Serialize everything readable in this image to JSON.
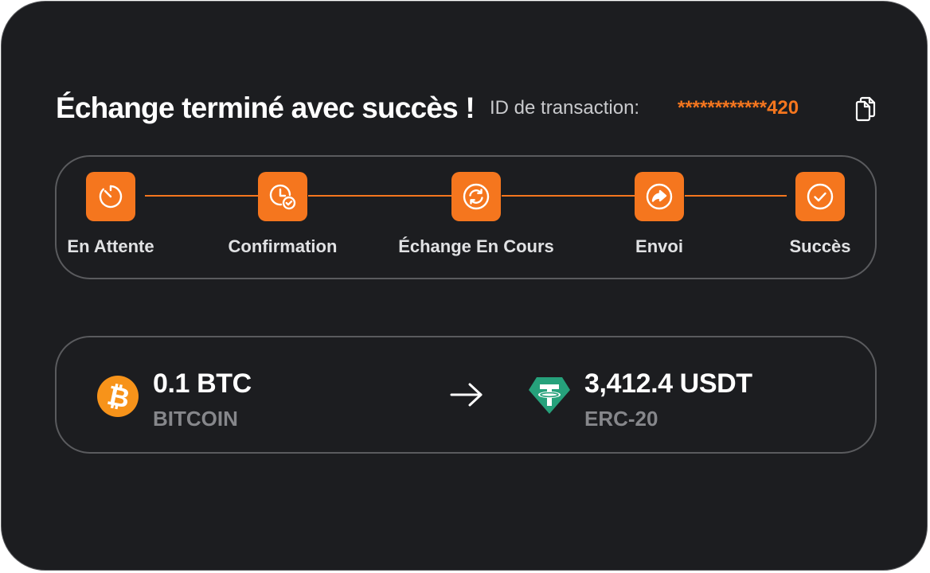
{
  "header": {
    "title": "Échange terminé avec succès !",
    "transaction_id_label": "ID de transaction:",
    "transaction_id_value": "************420",
    "copy_icon": "copy-icon"
  },
  "stepper": {
    "steps": [
      {
        "label": "En Attente",
        "icon": "timer-icon"
      },
      {
        "label": "Confirmation",
        "icon": "clock-check-icon"
      },
      {
        "label": "Échange En Cours",
        "icon": "refresh-icon"
      },
      {
        "label": "Envoi",
        "icon": "send-arrow-icon"
      },
      {
        "label": "Succès",
        "icon": "check-circle-icon"
      }
    ]
  },
  "swap": {
    "from": {
      "amount": "0.1 BTC",
      "network": "BITCOIN",
      "icon": "bitcoin-icon"
    },
    "to": {
      "amount": "3,412.4 USDT",
      "network": "ERC-20",
      "icon": "tether-icon"
    },
    "arrow_icon": "arrow-right-icon"
  },
  "colors": {
    "background": "#1c1d20",
    "accent": "#f5761e",
    "border": "#5a5b5e",
    "muted_text": "#86878b",
    "bitcoin": "#f7931a",
    "tether": "#26a17b"
  }
}
